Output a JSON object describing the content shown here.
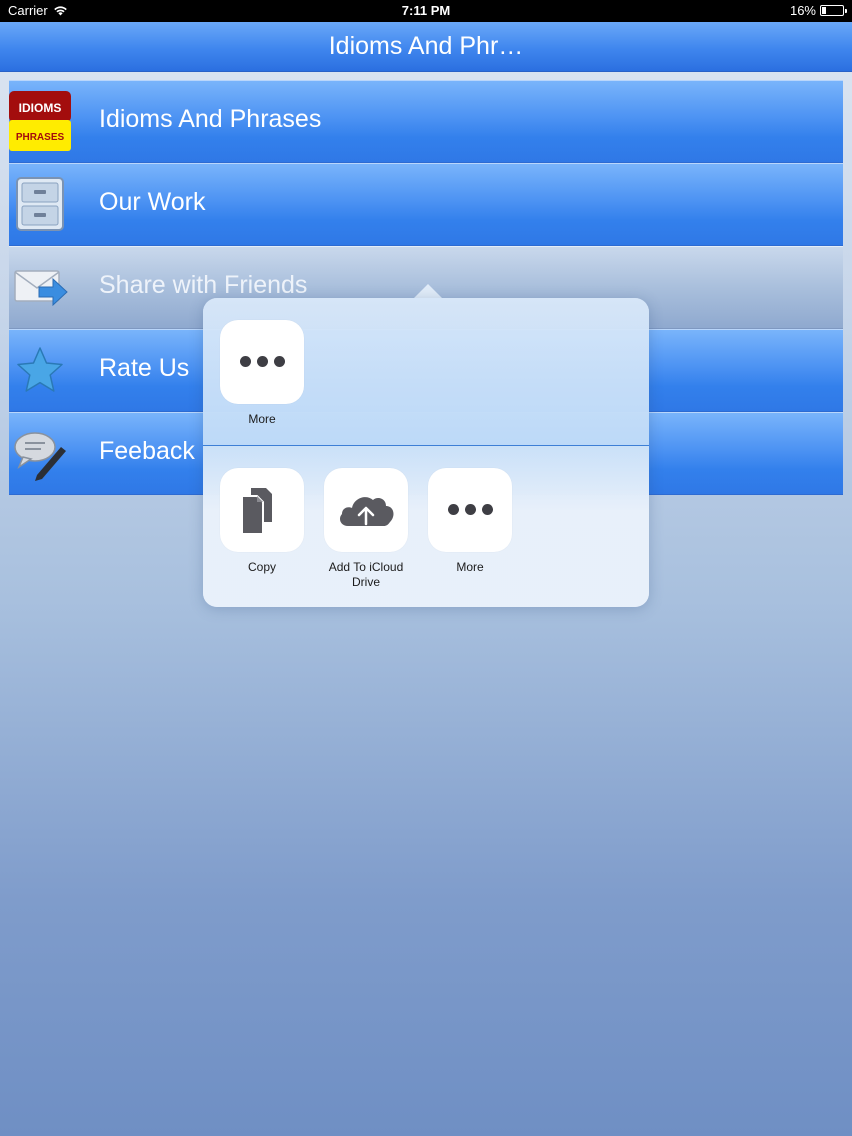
{
  "status_bar": {
    "carrier": "Carrier",
    "time": "7:11 PM",
    "battery": "16%",
    "battery_level": 0.16
  },
  "nav": {
    "title": "Idioms And Phr…"
  },
  "menu": {
    "items": [
      {
        "label": "Idioms And Phrases",
        "icon": "idioms-phrases-logo-icon",
        "logo_text_top": "IDIOMS",
        "logo_text_bottom": "PHRASES"
      },
      {
        "label": "Our Work",
        "icon": "filing-cabinet-icon"
      },
      {
        "label": "Share with Friends",
        "icon": "mail-forward-icon"
      },
      {
        "label": "Rate Us",
        "icon": "star-icon"
      },
      {
        "label": "Feeback",
        "icon": "comment-pencil-icon"
      }
    ]
  },
  "share_sheet": {
    "top_actions": [
      {
        "label": "More",
        "icon": "more-dots-icon"
      }
    ],
    "bottom_actions": [
      {
        "label": "Copy",
        "icon": "copy-documents-icon"
      },
      {
        "label": "Add To iCloud Drive",
        "label_line1": "Add To iCloud",
        "label_line2": "Drive",
        "icon": "icloud-upload-icon"
      },
      {
        "label": "More",
        "icon": "more-dots-icon"
      }
    ]
  },
  "colors": {
    "nav_blue": "#3f86ee",
    "row_blue": "#4d93f3",
    "icon_gray": "#5a5a60"
  }
}
